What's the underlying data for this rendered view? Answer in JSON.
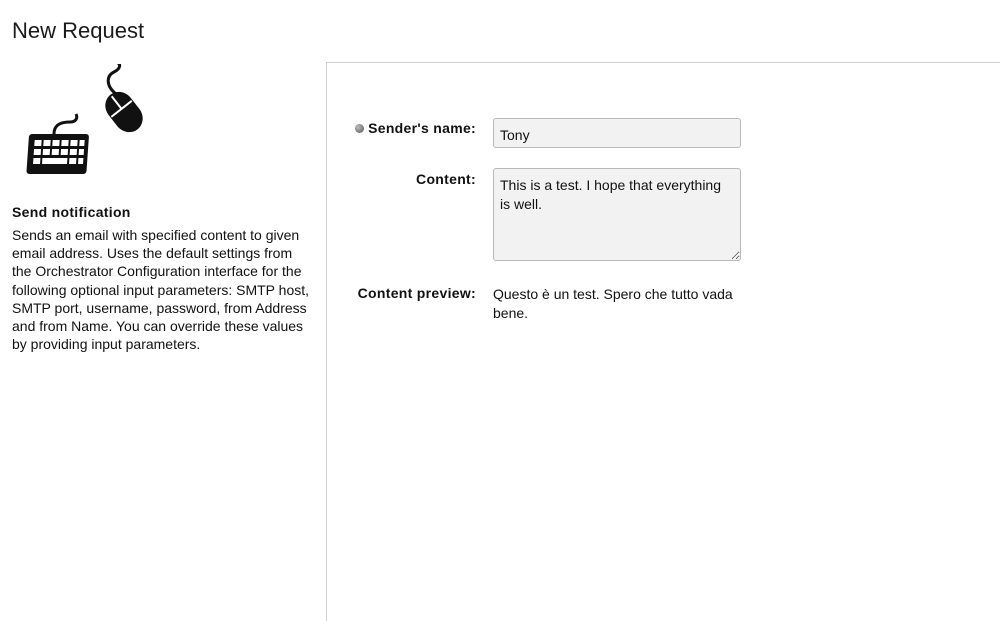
{
  "page": {
    "title": "New Request"
  },
  "workflow": {
    "icon": "keyboard-mouse-icon",
    "name": "Send notification",
    "description": "Sends an email with specified content to given email address. Uses the default settings from the Orchestrator Configuration interface for the following optional input parameters: SMTP host, SMTP port, username, password, from Address and from Name. You can override these values by providing input parameters."
  },
  "form": {
    "sender_name": {
      "label": "Sender's name:",
      "value": "Tony",
      "required": true
    },
    "content": {
      "label": "Content:",
      "value": "This is a test. I hope that everything is well."
    },
    "content_preview": {
      "label": "Content preview:",
      "value": "Questo è un test. Spero che tutto vada bene."
    }
  },
  "colors": {
    "field_background": "#f2f2f2",
    "field_border": "#b9b9b9",
    "panel_border": "#cfcfcf"
  }
}
